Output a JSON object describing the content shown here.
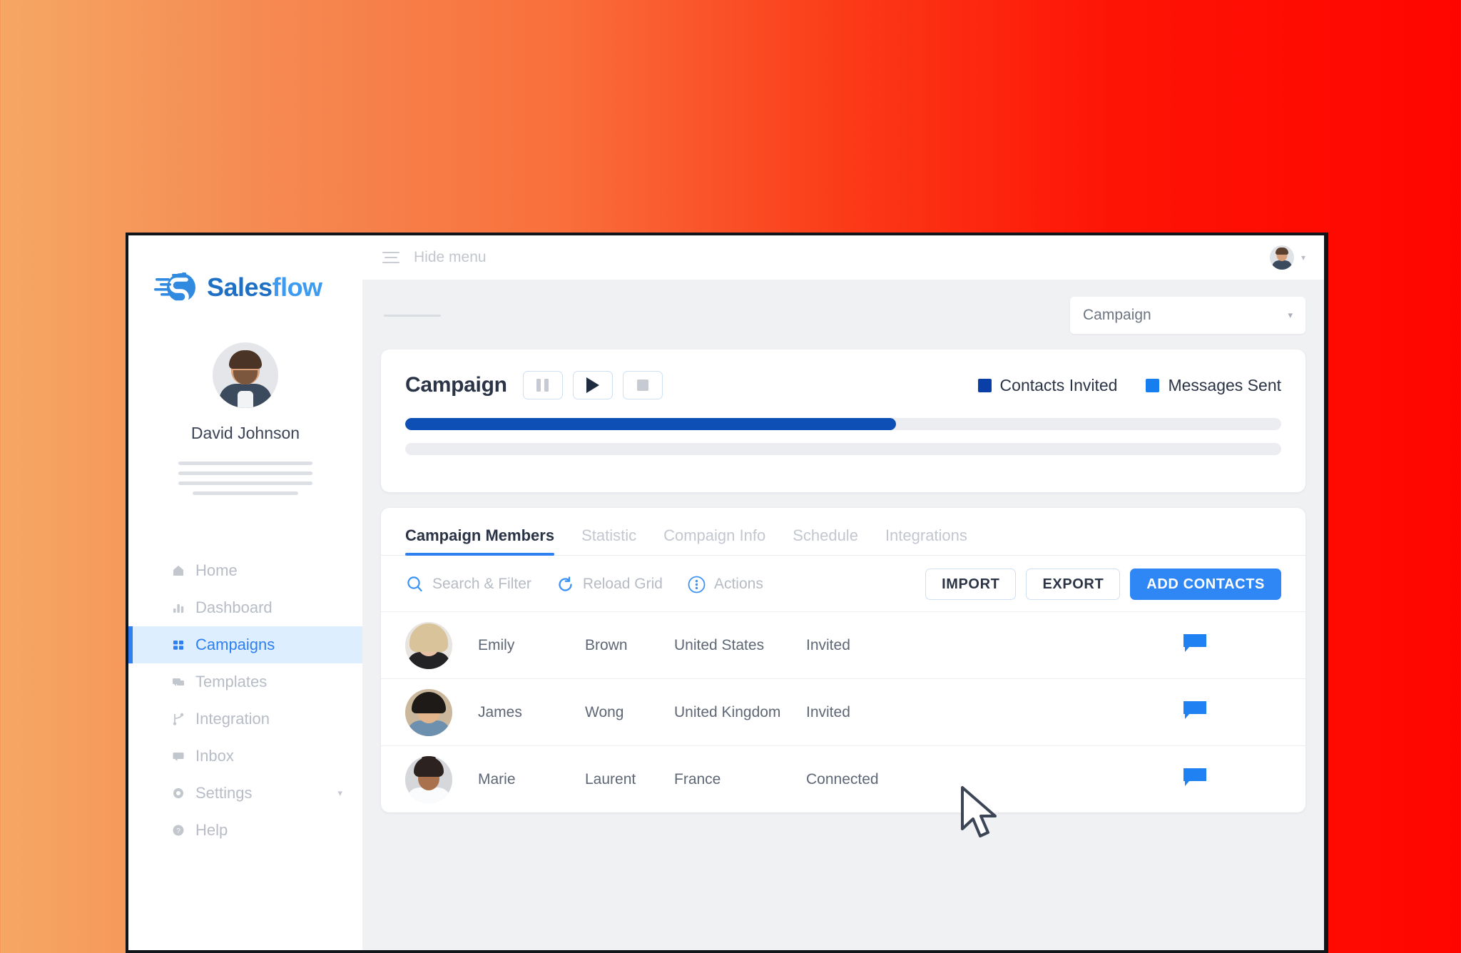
{
  "brand": {
    "name_part1": "Sales",
    "name_part2": "flow",
    "logo_icon": "salesflow-logo-icon",
    "color_primary": "#1f6fc4",
    "color_secondary": "#3d9bf2"
  },
  "sidebar": {
    "user_name": "David Johnson",
    "avatar_icon": "user-avatar",
    "items": [
      {
        "label": "Home",
        "icon": "home-icon",
        "active": false,
        "caret": false
      },
      {
        "label": "Dashboard",
        "icon": "dashboard-chart-icon",
        "active": false,
        "caret": false
      },
      {
        "label": "Campaigns",
        "icon": "campaigns-grid-icon",
        "active": true,
        "caret": false
      },
      {
        "label": "Templates",
        "icon": "templates-message-icon",
        "active": false,
        "caret": false
      },
      {
        "label": "Integration",
        "icon": "integration-branch-icon",
        "active": false,
        "caret": false
      },
      {
        "label": "Inbox",
        "icon": "inbox-icon",
        "active": false,
        "caret": false
      },
      {
        "label": "Settings",
        "icon": "gear-icon",
        "active": false,
        "caret": true
      },
      {
        "label": "Help",
        "icon": "help-circle-icon",
        "active": false,
        "caret": false
      }
    ],
    "active_color": "#2e7ff0",
    "active_bg": "#ddeeff"
  },
  "topbar": {
    "hide_menu_label": "Hide menu",
    "menu_icon": "hamburger-icon",
    "avatar_icon": "user-avatar-small",
    "caret_icon": "chevron-down-icon"
  },
  "campaign_select": {
    "value": "Campaign",
    "caret_icon": "chevron-down-icon"
  },
  "campaign_card": {
    "title": "Campaign",
    "controls": [
      {
        "name": "pause-button",
        "icon": "pause-icon"
      },
      {
        "name": "play-button",
        "icon": "play-icon"
      },
      {
        "name": "stop-button",
        "icon": "stop-icon"
      }
    ],
    "legend": [
      {
        "label": "Contacts Invited",
        "color": "#0a3fa8"
      },
      {
        "label": "Messages Sent",
        "color": "#177ef0"
      }
    ],
    "progress": [
      {
        "name": "contacts-invited-progress",
        "percent": 56,
        "color": "#0e4fb5"
      },
      {
        "name": "messages-sent-progress",
        "percent": 0,
        "color": "#177ef0"
      }
    ]
  },
  "grid": {
    "tabs": [
      {
        "label": "Campaign Members",
        "active": true
      },
      {
        "label": "Statistic",
        "active": false
      },
      {
        "label": "Compaign Info",
        "active": false
      },
      {
        "label": "Schedule",
        "active": false
      },
      {
        "label": "Integrations",
        "active": false
      }
    ],
    "tools": [
      {
        "label": "Search & Filter",
        "icon": "search-icon"
      },
      {
        "label": "Reload Grid",
        "icon": "reload-icon"
      },
      {
        "label": "Actions",
        "icon": "more-vertical-icon"
      }
    ],
    "buttons": [
      {
        "label": "IMPORT",
        "style": "outline"
      },
      {
        "label": "EXPORT",
        "style": "outline"
      },
      {
        "label": "ADD CONTACTS",
        "style": "filled"
      }
    ],
    "accent_color": "#2e87f5",
    "rows": [
      {
        "first_name": "Emily",
        "last_name": "Brown",
        "country": "United States",
        "status": "Invited",
        "avatar": "contact-avatar-emily",
        "action_icon": "chat-bubble-icon"
      },
      {
        "first_name": "James",
        "last_name": "Wong",
        "country": "United Kingdom",
        "status": "Invited",
        "avatar": "contact-avatar-james",
        "action_icon": "chat-bubble-icon"
      },
      {
        "first_name": "Marie",
        "last_name": "Laurent",
        "country": "France",
        "status": "Connected",
        "avatar": "contact-avatar-marie",
        "action_icon": "chat-bubble-icon"
      }
    ]
  },
  "cursor": {
    "icon": "mouse-pointer-icon"
  }
}
